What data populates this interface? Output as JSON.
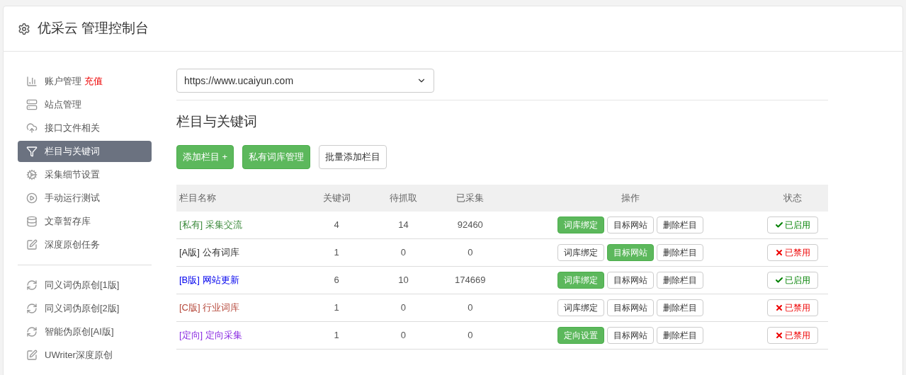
{
  "header": {
    "title": "优采云 管理控制台"
  },
  "sidebar": {
    "groups": [
      [
        {
          "label": "账户管理",
          "badge": "充值",
          "selected": false
        },
        {
          "label": "站点管理",
          "selected": false
        },
        {
          "label": "接口文件相关",
          "selected": false
        },
        {
          "label": "栏目与关键词",
          "selected": true
        },
        {
          "label": "采集细节设置",
          "selected": false
        },
        {
          "label": "手动运行测试",
          "selected": false
        },
        {
          "label": "文章暂存库",
          "selected": false
        },
        {
          "label": "深度原创任务",
          "selected": false
        }
      ],
      [
        {
          "label": "同义词伪原创[1版]",
          "selected": false
        },
        {
          "label": "同义词伪原创[2版]",
          "selected": false
        },
        {
          "label": "智能伪原创[AI版]",
          "selected": false
        },
        {
          "label": "UWriter深度原创",
          "selected": false
        }
      ]
    ]
  },
  "site_select": {
    "value": "https://www.ucaiyun.com"
  },
  "section_title": "栏目与关键词",
  "toolbar": [
    {
      "label": "添加栏目 +",
      "primary": true
    },
    {
      "label": "私有词库管理",
      "primary": true
    },
    {
      "label": "批量添加栏目",
      "primary": false
    }
  ],
  "table": {
    "columns": [
      "栏目名称",
      "关键词",
      "待抓取",
      "已采集",
      "操作",
      "状态"
    ],
    "rows": [
      {
        "tag": "[私有]",
        "name": "采集交流",
        "color": "#3c8a3c",
        "keywords": "4",
        "pending": "14",
        "collected": "92460",
        "actions": [
          {
            "label": "词库绑定",
            "primary": true
          },
          {
            "label": "目标网站",
            "primary": false
          },
          {
            "label": "删除栏目",
            "primary": false
          }
        ],
        "enabled": true,
        "status": "已启用"
      },
      {
        "tag": "[A版]",
        "name": "公有词库",
        "color": "#333333",
        "keywords": "1",
        "pending": "0",
        "collected": "0",
        "actions": [
          {
            "label": "词库绑定",
            "primary": false
          },
          {
            "label": "目标网站",
            "primary": true
          },
          {
            "label": "删除栏目",
            "primary": false
          }
        ],
        "enabled": false,
        "status": "已禁用"
      },
      {
        "tag": "[B版]",
        "name": "网站更新",
        "color": "#0000ee",
        "keywords": "6",
        "pending": "10",
        "collected": "174669",
        "actions": [
          {
            "label": "词库绑定",
            "primary": true
          },
          {
            "label": "目标网站",
            "primary": false
          },
          {
            "label": "删除栏目",
            "primary": false
          }
        ],
        "enabled": true,
        "status": "已启用"
      },
      {
        "tag": "[C版]",
        "name": "行业词库",
        "color": "#b5473a",
        "keywords": "1",
        "pending": "0",
        "collected": "0",
        "actions": [
          {
            "label": "词库绑定",
            "primary": false
          },
          {
            "label": "目标网站",
            "primary": false
          },
          {
            "label": "删除栏目",
            "primary": false
          }
        ],
        "enabled": false,
        "status": "已禁用"
      },
      {
        "tag": "[定向]",
        "name": "定向采集",
        "color": "#8a2be2",
        "keywords": "1",
        "pending": "0",
        "collected": "0",
        "actions": [
          {
            "label": "定向设置",
            "primary": true
          },
          {
            "label": "目标网站",
            "primary": false
          },
          {
            "label": "删除栏目",
            "primary": false
          }
        ],
        "enabled": false,
        "status": "已禁用"
      }
    ]
  }
}
